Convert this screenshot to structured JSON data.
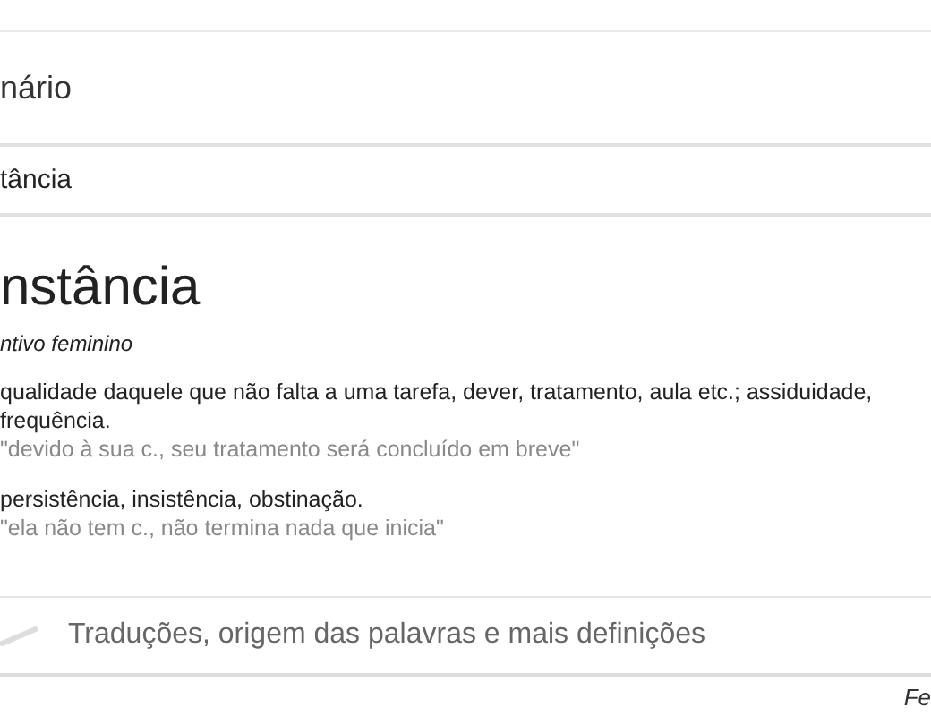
{
  "header": {
    "title": "nário"
  },
  "search": {
    "value": "tância"
  },
  "entry": {
    "word": "nstância",
    "class": "ntivo feminino",
    "definitions": [
      {
        "text": "qualidade daquele que não falta a uma tarefa, dever, tratamento, aula etc.; assiduidade, frequência.",
        "example": "\"devido à sua c., seu tratamento será concluído em breve\""
      },
      {
        "text": "persistência, insistência, obstinação.",
        "example": "\"ela não tem c., não termina nada que inicia\""
      }
    ]
  },
  "more_link": "Traduções, origem das palavras e mais definições",
  "footer": "Fe"
}
